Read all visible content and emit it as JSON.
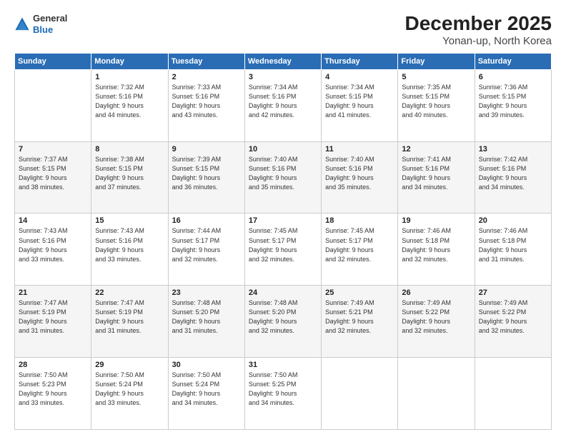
{
  "logo": {
    "general": "General",
    "blue": "Blue"
  },
  "title": "December 2025",
  "subtitle": "Yonan-up, North Korea",
  "days_of_week": [
    "Sunday",
    "Monday",
    "Tuesday",
    "Wednesday",
    "Thursday",
    "Friday",
    "Saturday"
  ],
  "weeks": [
    [
      {
        "day": "",
        "info": ""
      },
      {
        "day": "1",
        "info": "Sunrise: 7:32 AM\nSunset: 5:16 PM\nDaylight: 9 hours\nand 44 minutes."
      },
      {
        "day": "2",
        "info": "Sunrise: 7:33 AM\nSunset: 5:16 PM\nDaylight: 9 hours\nand 43 minutes."
      },
      {
        "day": "3",
        "info": "Sunrise: 7:34 AM\nSunset: 5:16 PM\nDaylight: 9 hours\nand 42 minutes."
      },
      {
        "day": "4",
        "info": "Sunrise: 7:34 AM\nSunset: 5:15 PM\nDaylight: 9 hours\nand 41 minutes."
      },
      {
        "day": "5",
        "info": "Sunrise: 7:35 AM\nSunset: 5:15 PM\nDaylight: 9 hours\nand 40 minutes."
      },
      {
        "day": "6",
        "info": "Sunrise: 7:36 AM\nSunset: 5:15 PM\nDaylight: 9 hours\nand 39 minutes."
      }
    ],
    [
      {
        "day": "7",
        "info": "Sunrise: 7:37 AM\nSunset: 5:15 PM\nDaylight: 9 hours\nand 38 minutes."
      },
      {
        "day": "8",
        "info": "Sunrise: 7:38 AM\nSunset: 5:15 PM\nDaylight: 9 hours\nand 37 minutes."
      },
      {
        "day": "9",
        "info": "Sunrise: 7:39 AM\nSunset: 5:15 PM\nDaylight: 9 hours\nand 36 minutes."
      },
      {
        "day": "10",
        "info": "Sunrise: 7:40 AM\nSunset: 5:16 PM\nDaylight: 9 hours\nand 35 minutes."
      },
      {
        "day": "11",
        "info": "Sunrise: 7:40 AM\nSunset: 5:16 PM\nDaylight: 9 hours\nand 35 minutes."
      },
      {
        "day": "12",
        "info": "Sunrise: 7:41 AM\nSunset: 5:16 PM\nDaylight: 9 hours\nand 34 minutes."
      },
      {
        "day": "13",
        "info": "Sunrise: 7:42 AM\nSunset: 5:16 PM\nDaylight: 9 hours\nand 34 minutes."
      }
    ],
    [
      {
        "day": "14",
        "info": "Sunrise: 7:43 AM\nSunset: 5:16 PM\nDaylight: 9 hours\nand 33 minutes."
      },
      {
        "day": "15",
        "info": "Sunrise: 7:43 AM\nSunset: 5:16 PM\nDaylight: 9 hours\nand 33 minutes."
      },
      {
        "day": "16",
        "info": "Sunrise: 7:44 AM\nSunset: 5:17 PM\nDaylight: 9 hours\nand 32 minutes."
      },
      {
        "day": "17",
        "info": "Sunrise: 7:45 AM\nSunset: 5:17 PM\nDaylight: 9 hours\nand 32 minutes."
      },
      {
        "day": "18",
        "info": "Sunrise: 7:45 AM\nSunset: 5:17 PM\nDaylight: 9 hours\nand 32 minutes."
      },
      {
        "day": "19",
        "info": "Sunrise: 7:46 AM\nSunset: 5:18 PM\nDaylight: 9 hours\nand 32 minutes."
      },
      {
        "day": "20",
        "info": "Sunrise: 7:46 AM\nSunset: 5:18 PM\nDaylight: 9 hours\nand 31 minutes."
      }
    ],
    [
      {
        "day": "21",
        "info": "Sunrise: 7:47 AM\nSunset: 5:19 PM\nDaylight: 9 hours\nand 31 minutes."
      },
      {
        "day": "22",
        "info": "Sunrise: 7:47 AM\nSunset: 5:19 PM\nDaylight: 9 hours\nand 31 minutes."
      },
      {
        "day": "23",
        "info": "Sunrise: 7:48 AM\nSunset: 5:20 PM\nDaylight: 9 hours\nand 31 minutes."
      },
      {
        "day": "24",
        "info": "Sunrise: 7:48 AM\nSunset: 5:20 PM\nDaylight: 9 hours\nand 32 minutes."
      },
      {
        "day": "25",
        "info": "Sunrise: 7:49 AM\nSunset: 5:21 PM\nDaylight: 9 hours\nand 32 minutes."
      },
      {
        "day": "26",
        "info": "Sunrise: 7:49 AM\nSunset: 5:22 PM\nDaylight: 9 hours\nand 32 minutes."
      },
      {
        "day": "27",
        "info": "Sunrise: 7:49 AM\nSunset: 5:22 PM\nDaylight: 9 hours\nand 32 minutes."
      }
    ],
    [
      {
        "day": "28",
        "info": "Sunrise: 7:50 AM\nSunset: 5:23 PM\nDaylight: 9 hours\nand 33 minutes."
      },
      {
        "day": "29",
        "info": "Sunrise: 7:50 AM\nSunset: 5:24 PM\nDaylight: 9 hours\nand 33 minutes."
      },
      {
        "day": "30",
        "info": "Sunrise: 7:50 AM\nSunset: 5:24 PM\nDaylight: 9 hours\nand 34 minutes."
      },
      {
        "day": "31",
        "info": "Sunrise: 7:50 AM\nSunset: 5:25 PM\nDaylight: 9 hours\nand 34 minutes."
      },
      {
        "day": "",
        "info": ""
      },
      {
        "day": "",
        "info": ""
      },
      {
        "day": "",
        "info": ""
      }
    ]
  ]
}
